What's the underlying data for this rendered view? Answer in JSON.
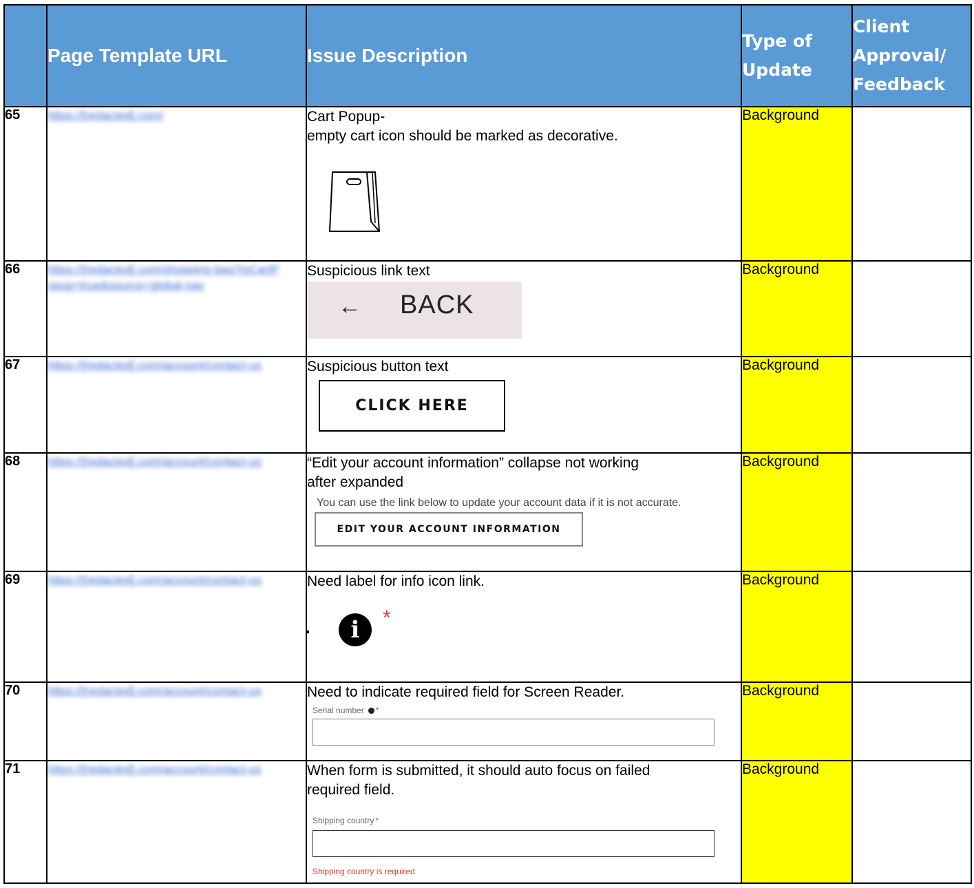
{
  "header": {
    "url": "Page Template URL",
    "desc": "Issue Description",
    "type": "Type of Update",
    "client": "Client Approval/ Feedback"
  },
  "rows": [
    {
      "num": "65",
      "url": "https://[redacted].com/",
      "desc": [
        "Cart Popup-",
        "empty cart icon should be marked as decorative."
      ],
      "type": "Background",
      "illustration": "empty-bag-icon"
    },
    {
      "num": "66",
      "url": "https://[redacted].com/shopping-bag?isCartPopup=true&source=global-nav",
      "desc": [
        "Suspicious link text"
      ],
      "type": "Background",
      "back_arrow": "←",
      "back_label": "BACK"
    },
    {
      "num": "67",
      "url": "https://[redacted].com/account/contact-us",
      "desc": [
        "Suspicious button text"
      ],
      "type": "Background",
      "button_label": "CLICK HERE"
    },
    {
      "num": "68",
      "url": "https://[redacted].com/account/contact-us",
      "desc": [
        "“Edit your account information” collapse not working",
        "after expanded"
      ],
      "type": "Background",
      "note": "You can use the link below to update your account data if it is not accurate.",
      "button_label": "EDIT YOUR ACCOUNT INFORMATION"
    },
    {
      "num": "69",
      "url": "https://[redacted].com/account/contact-us",
      "desc": [
        "Need label for info icon link."
      ],
      "type": "Background",
      "info_glyph": "i",
      "required_mark": "*"
    },
    {
      "num": "70",
      "url": "https://[redacted].com/account/contact-us",
      "desc": [
        "Need to indicate required field for Screen Reader."
      ],
      "type": "Background",
      "field_label": "Serial number",
      "required_mark": "*"
    },
    {
      "num": "71",
      "url": "https://[redacted].com/account/contact-us",
      "desc": [
        "When form is submitted, it should auto focus on failed",
        "required field."
      ],
      "type": "Background",
      "field_label": "Shipping country",
      "required_mark": "*",
      "error": "Shipping country is required"
    }
  ],
  "colors": {
    "header_bg": "#5b9bd5",
    "type_bg": "#ffff00",
    "error": "#e53935"
  }
}
